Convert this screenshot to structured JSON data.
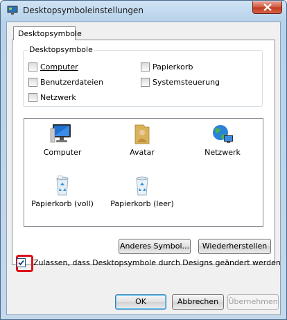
{
  "window": {
    "title": "Desktopsymboleinstellungen"
  },
  "tab": {
    "label": "Desktopsymbole"
  },
  "group": {
    "legend": "Desktopsymbole",
    "checkboxes": [
      {
        "label": "Computer",
        "checked": false
      },
      {
        "label": "Papierkorb",
        "checked": false
      },
      {
        "label": "Benutzerdateien",
        "checked": false
      },
      {
        "label": "Systemsteuerung",
        "checked": false
      },
      {
        "label": "Netzwerk",
        "checked": false
      }
    ]
  },
  "icons": [
    {
      "label": "Computer",
      "icon": "computer-icon"
    },
    {
      "label": "Avatar",
      "icon": "user-folder-icon"
    },
    {
      "label": "Netzwerk",
      "icon": "network-globe-icon"
    },
    {
      "label": "Papierkorb (voll)",
      "icon": "recycle-bin-full-icon"
    },
    {
      "label": "Papierkorb (leer)",
      "icon": "recycle-bin-empty-icon"
    }
  ],
  "buttons": {
    "change_icon": "Anderes Symbol...",
    "restore": "Wiederherstellen",
    "ok": "OK",
    "cancel": "Abbrechen",
    "apply": "Übernehmen"
  },
  "allow_themes": {
    "label": "Zulassen, dass Desktopsymbole durch Designs geändert werden",
    "checked": true
  },
  "colors": {
    "highlight": "#d9121c",
    "close_button": "#c8452a"
  }
}
